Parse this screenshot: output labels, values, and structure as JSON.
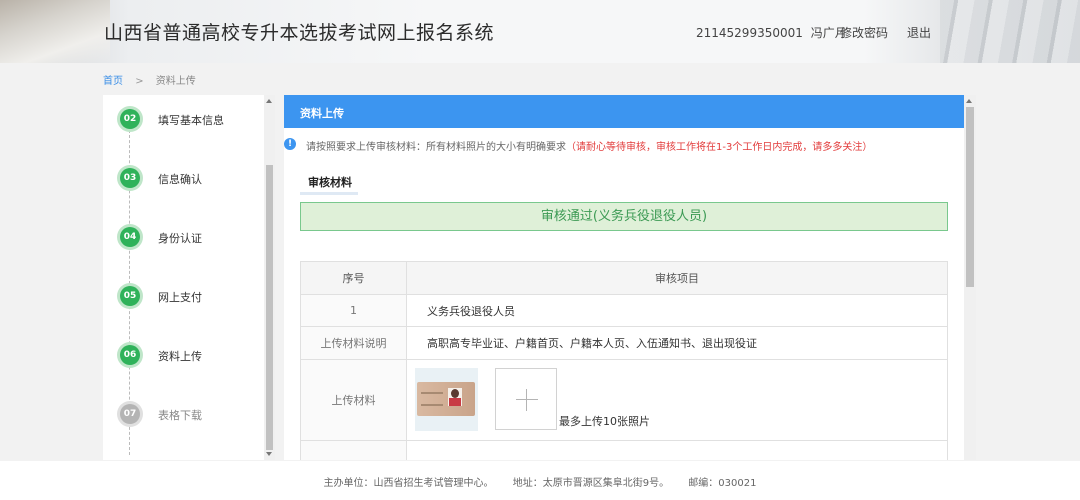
{
  "header": {
    "title": "山西省普通高校专升本选拔考试网上报名系统",
    "user_id": "21145299350001",
    "user_name": "冯广月",
    "change_password": "修改密码",
    "logout": "退出"
  },
  "breadcrumb": {
    "home": "首页",
    "separator": ">",
    "current": "资料上传"
  },
  "sidebar": {
    "steps": [
      {
        "num": "02",
        "label": "填写基本信息",
        "state": "done"
      },
      {
        "num": "03",
        "label": "信息确认",
        "state": "done"
      },
      {
        "num": "04",
        "label": "身份认证",
        "state": "done"
      },
      {
        "num": "05",
        "label": "网上支付",
        "state": "done"
      },
      {
        "num": "06",
        "label": "资料上传",
        "state": "done"
      },
      {
        "num": "07",
        "label": "表格下载",
        "state": "pending"
      }
    ]
  },
  "main": {
    "panel_title": "资料上传",
    "notice_icon": "!",
    "notice_text": "请按照要求上传审核材料：所有材料照片的大小有明确要求",
    "notice_red": "（请耐心等待审核，审核工作将在1-3个工作日内完成，请多多关注）",
    "section_title": "审核材料",
    "status": "审核通过(义务兵役退役人员)",
    "table": {
      "headers": [
        "序号",
        "审核项目"
      ],
      "row1": {
        "key": "1",
        "value": "义务兵役退役人员"
      },
      "row2": {
        "key": "上传材料说明",
        "value": "高职高专毕业证、户籍首页、户籍本人页、入伍通知书、退出现役证"
      },
      "row3": {
        "key": "上传材料",
        "note": "最多上传10张照片"
      }
    }
  },
  "footer": {
    "organizer": "主办单位：山西省招生考试管理中心。",
    "address": "地址：太原市晋源区集阜北街9号。",
    "postcode": "邮编：030021"
  },
  "colors": {
    "accent": "#3c95f0",
    "step_done": "#2fb25a",
    "status_bg": "#dff0d8",
    "notice_red": "#e23b3b"
  }
}
